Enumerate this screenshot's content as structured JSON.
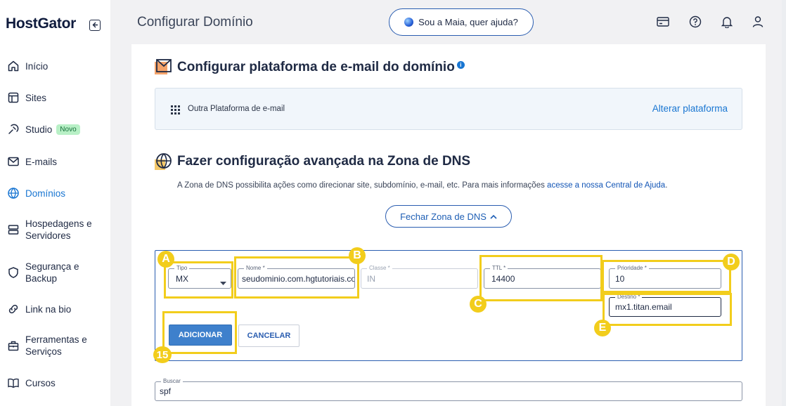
{
  "sidebar": {
    "logo": "HostGator",
    "items": [
      {
        "label": "Início",
        "icon": "home-icon"
      },
      {
        "label": "Sites",
        "icon": "sites-icon"
      },
      {
        "label": "Studio",
        "icon": "studio-icon",
        "badge": "Novo"
      },
      {
        "label": "E-mails",
        "icon": "mail-icon"
      },
      {
        "label": "Domínios",
        "icon": "globe-icon",
        "active": true
      },
      {
        "label": "Hospedagens e Servidores",
        "icon": "server-icon"
      },
      {
        "label": "Segurança e Backup",
        "icon": "shield-icon"
      },
      {
        "label": "Link na bio",
        "icon": "link-icon"
      },
      {
        "label": "Ferramentas e Serviços",
        "icon": "tools-icon"
      },
      {
        "label": "Cursos",
        "icon": "book-icon"
      }
    ]
  },
  "header": {
    "title": "Configurar Domínio",
    "assistant_label": "Sou a Maia, quer ajuda?",
    "icons": [
      "billing-icon",
      "help-icon",
      "notifications-icon",
      "user-icon"
    ]
  },
  "email_section": {
    "title": "Configurar plataforma de e-mail do domínio",
    "info": "i",
    "platform_label": "Outra Plataforma de e-mail",
    "change_link": "Alterar plataforma"
  },
  "dns_section": {
    "title": "Fazer configuração avançada na Zona de DNS",
    "description": "A Zona de DNS possibilita ações como direcionar site, subdomínio, e-mail, etc. Para mais informações ",
    "help_link": "acesse a nossa Central de Ajuda",
    "description_end": ".",
    "close_button": "Fechar Zona de DNS"
  },
  "form": {
    "tipo": {
      "label": "Tipo",
      "value": "MX"
    },
    "nome": {
      "label": "Nome *",
      "value": "seudominio.com.hgtutoriais.co"
    },
    "classe": {
      "label": "Classe *",
      "value": "IN"
    },
    "ttl": {
      "label": "TTL *",
      "value": "14400"
    },
    "prioridade": {
      "label": "Prioridade *",
      "value": "10"
    },
    "destino": {
      "label": "Destino *",
      "value": "mx1.titan.email"
    },
    "add_button": "ADICIONAR",
    "cancel_button": "CANCELAR"
  },
  "annotations": {
    "a": "A",
    "b": "B",
    "c": "C",
    "d": "D",
    "e": "E",
    "step": "15"
  },
  "search": {
    "label": "Buscar",
    "value": "spf"
  },
  "colors": {
    "accent": "#1976d2",
    "highlight": "#f2cd1c",
    "primary_button": "#3e80cc"
  }
}
